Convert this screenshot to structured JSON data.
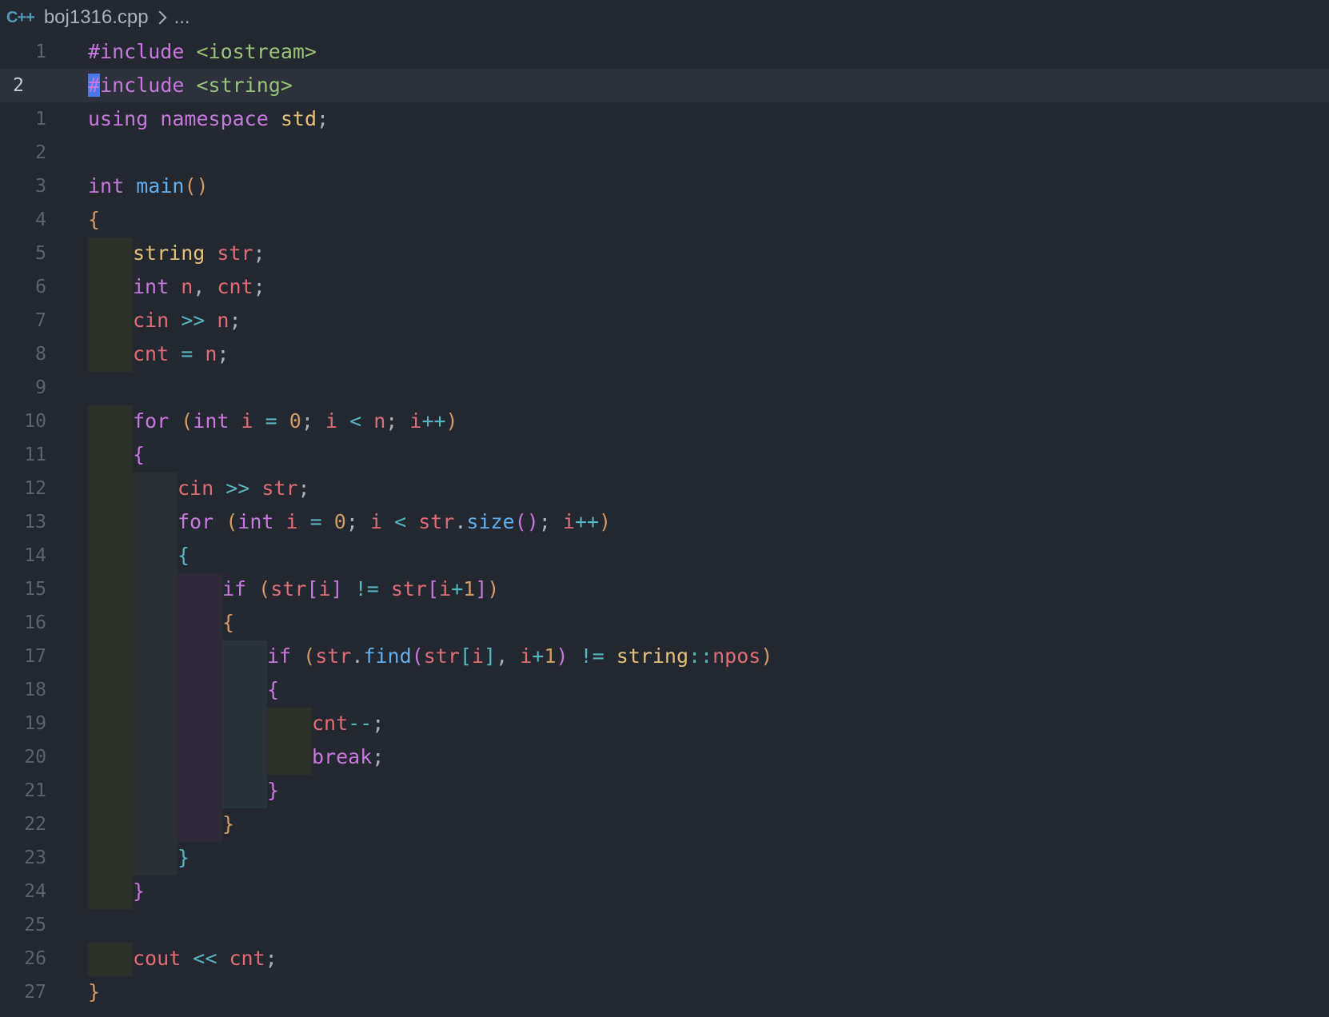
{
  "breadcrumb": {
    "language_icon": "cpp-icon",
    "language_label": "C++",
    "file": "boj1316.cpp",
    "separator_icon": "chevron-right-icon",
    "ellipsis": "..."
  },
  "editor": {
    "current_line_number": "2",
    "lines": [
      {
        "number": "1",
        "text": "#include <iostream>"
      },
      {
        "number": "2",
        "text": "#include <string>",
        "current": true
      },
      {
        "number": "1",
        "text": "using namespace std;"
      },
      {
        "number": "2",
        "text": ""
      },
      {
        "number": "3",
        "text": "int main()"
      },
      {
        "number": "4",
        "text": "{"
      },
      {
        "number": "5",
        "text": "string str;"
      },
      {
        "number": "6",
        "text": "int n, cnt;"
      },
      {
        "number": "7",
        "text": "cin >> n;"
      },
      {
        "number": "8",
        "text": "cnt = n;"
      },
      {
        "number": "9",
        "text": ""
      },
      {
        "number": "10",
        "text": "for (int i = 0; i < n; i++)"
      },
      {
        "number": "11",
        "text": "{"
      },
      {
        "number": "12",
        "text": "cin >> str;"
      },
      {
        "number": "13",
        "text": "for (int i = 0; i < str.size(); i++)"
      },
      {
        "number": "14",
        "text": "{"
      },
      {
        "number": "15",
        "text": "if (str[i] != str[i+1])"
      },
      {
        "number": "16",
        "text": "{"
      },
      {
        "number": "17",
        "text": "if (str.find(str[i], i+1) != string::npos)"
      },
      {
        "number": "18",
        "text": "{"
      },
      {
        "number": "19",
        "text": "cnt--;"
      },
      {
        "number": "20",
        "text": "break;"
      },
      {
        "number": "21",
        "text": "}"
      },
      {
        "number": "22",
        "text": "}"
      },
      {
        "number": "23",
        "text": "}"
      },
      {
        "number": "24",
        "text": "}"
      },
      {
        "number": "25",
        "text": ""
      },
      {
        "number": "26",
        "text": "cout << cnt;"
      },
      {
        "number": "27",
        "text": "}"
      }
    ]
  },
  "colors": {
    "background": "#23272f",
    "current_line": "#2c313c",
    "keyword": "#c678dd",
    "type": "#e5c07b",
    "function": "#61afef",
    "variable": "#e06c75",
    "number": "#d19a66",
    "string": "#98c379",
    "operator": "#56b6c2",
    "cursor": "#4b78e8"
  }
}
